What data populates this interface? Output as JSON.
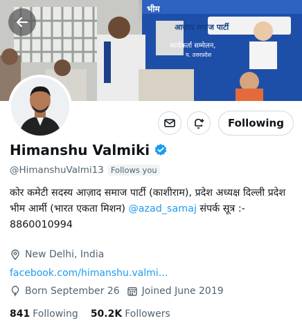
{
  "banner": {
    "overlay_texts": [
      "भीम",
      "आज़ाद समाज पार्टी",
      "कार्यकर्ता सम्मेलन,",
      "प. उत्तरप्रदेश"
    ]
  },
  "profile": {
    "name": "Himanshu Valmiki",
    "handle": "@HimanshuValmi13",
    "follows_you": "Follows you",
    "follow_button": "Following",
    "bio_part1": "कोर कमेटी सदस्य आज़ाद समाज पार्टी (काशीराम),  प्रदेश अध्यक्ष दिल्ली प्रदेश भीम आर्मी (भारत एकता मिशन) ",
    "bio_mention": "@azad_samaj",
    "bio_part2": " संपर्क सूत्र :- 8860010994",
    "location": "New Delhi, India",
    "website": "facebook.com/himanshu.valmi…",
    "born": "Born September 26",
    "joined": "Joined June 2019",
    "following_count": "841",
    "following_label": "Following",
    "followers_count": "50.2K",
    "followers_label": "Followers"
  },
  "colors": {
    "accent": "#1d9bf0",
    "muted": "#536471",
    "text": "#0f1419"
  }
}
